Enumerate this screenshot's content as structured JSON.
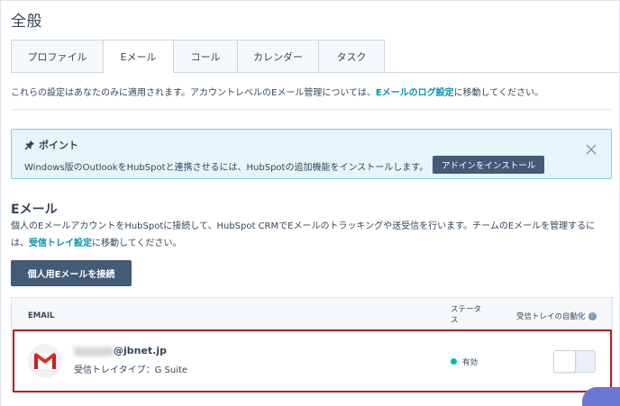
{
  "page": {
    "title": "全般"
  },
  "tabs": [
    {
      "label": "プロファイル",
      "active": false
    },
    {
      "label": "Eメール",
      "active": true
    },
    {
      "label": "コール",
      "active": false
    },
    {
      "label": "カレンダー",
      "active": false
    },
    {
      "label": "タスク",
      "active": false
    }
  ],
  "info": {
    "text_before": "これらの設定はあなたのみに適用されます。アカウントレベルのEメール管理については、",
    "link": "Eメールのログ設定",
    "text_after": "に移動してください。"
  },
  "tip": {
    "title": "ポイント",
    "text": "Windows版のOutlookをHubSpotと連携させるには、HubSpotの追加機能をインストールします。",
    "button": "アドインをインストール"
  },
  "email_section": {
    "title": "Eメール",
    "desc_before": "個人のEメールアカウントをHubSpotに接続して、HubSpot CRMでEメールのトラッキングや送受信を行います。チームのEメールを管理するには、",
    "desc_link": "受信トレイ設定",
    "desc_after": "に移動してください。",
    "connect_button": "個人用Eメールを接続"
  },
  "table": {
    "headers": {
      "email": "EMAIL",
      "status": "ステータス",
      "auto": "受信トレイの自動化"
    },
    "rows": [
      {
        "email_domain": "@jbnet.jp",
        "inbox_type": "受信トレイタイプ：G Suite",
        "status": "有効",
        "status_color": "#00bda5",
        "auto_enabled": false
      }
    ]
  },
  "colors": {
    "accent": "#0091ae",
    "button_dark": "#425b76",
    "tip_bg": "#e5f5f8",
    "highlight": "#b21e25"
  }
}
